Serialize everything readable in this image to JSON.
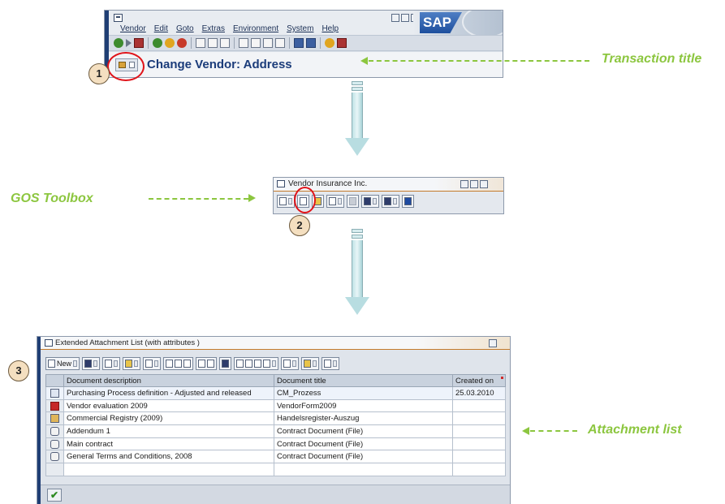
{
  "window1": {
    "menu": [
      "Vendor",
      "Edit",
      "Goto",
      "Extras",
      "Environment",
      "System",
      "Help"
    ],
    "logo": "SAP",
    "transaction_title": "Change Vendor: Address"
  },
  "gos_window": {
    "title": "Vendor Insurance Inc."
  },
  "attachment_window": {
    "title": "Extended Attachment List (with attributes )",
    "new_button": "New",
    "columns": [
      "Document description",
      "Document title",
      "Created on"
    ],
    "rows": [
      {
        "icon": "document-icon",
        "description": "Purchasing Process definition - Adjusted and released",
        "title": "CM_Prozess",
        "created": "25.03.2010"
      },
      {
        "icon": "pdf-icon",
        "description": "Vendor evaluation 2009",
        "title": "VendorForm2009",
        "created": ""
      },
      {
        "icon": "note-icon",
        "description": "Commercial Registry (2009)",
        "title": "Handelsregister-Auszug",
        "created": ""
      },
      {
        "icon": "attachment-icon",
        "description": "Addendum 1",
        "title": "Contract Document (File)",
        "created": ""
      },
      {
        "icon": "attachment-icon",
        "description": "Main contract",
        "title": "Contract Document (File)",
        "created": ""
      },
      {
        "icon": "attachment-icon",
        "description": "General Terms and Conditions, 2008",
        "title": "Contract Document (File)",
        "created": ""
      }
    ]
  },
  "annotations": {
    "transaction_title": "Transaction title",
    "gos_toolbox": "GOS Toolbox",
    "attachment_list": "Attachment list",
    "step1": "1",
    "step2": "2",
    "step3": "3"
  },
  "colors": {
    "callout_green": "#8cc63f",
    "highlight_red": "#e0141a",
    "sap_blue": "#1b3c7a"
  }
}
